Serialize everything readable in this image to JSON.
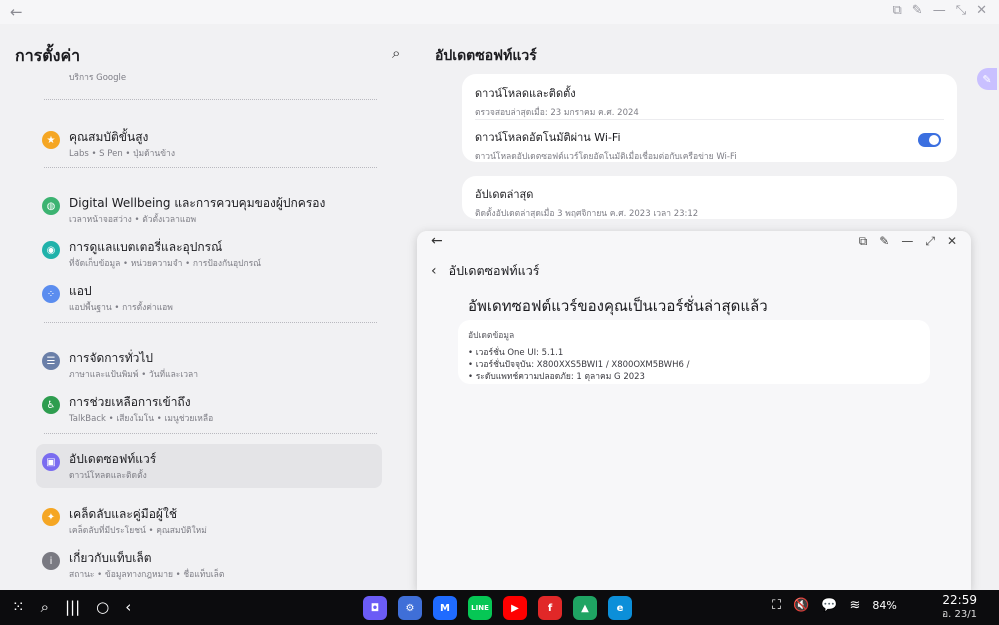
{
  "top_bar": {
    "back_icon": "arrow-left-icon"
  },
  "left_panel": {
    "title": "การตั้งค่า",
    "partial_subtitle": "บริการ Google",
    "items": [
      {
        "id": "advanced",
        "title": "คุณสมบัติขั้นสูง",
        "subtitle": "Labs  •  S Pen  •  ปุ่มด้านข้าง",
        "icon": "star-icon",
        "color": "#f5a623"
      },
      {
        "id": "wellbeing",
        "title": "Digital Wellbeing และการควบคุมของผู้ปกครอง",
        "subtitle": "เวลาหน้าจอสว่าง  •  ตัวตั้งเวลาแอพ",
        "icon": "wellbeing-icon",
        "color": "#3cb371"
      },
      {
        "id": "battery",
        "title": "การดูแลแบตเตอรี่และอุปกรณ์",
        "subtitle": "ที่จัดเก็บข้อมูล  •  หน่วยความจำ  •  การป้องกันอุปกรณ์",
        "icon": "device-care-icon",
        "color": "#20b2aa"
      },
      {
        "id": "apps",
        "title": "แอป",
        "subtitle": "แอปพื้นฐาน  •  การตั้งค่าแอพ",
        "icon": "apps-icon",
        "color": "#5b8def"
      },
      {
        "id": "general",
        "title": "การจัดการทั่วไป",
        "subtitle": "ภาษาและแป้นพิมพ์  •  วันที่และเวลา",
        "icon": "sliders-icon",
        "color": "#6a7fa8"
      },
      {
        "id": "accessibility",
        "title": "การช่วยเหลือการเข้าถึง",
        "subtitle": "TalkBack  •  เสียงโมโน  •  เมนูช่วยเหลือ",
        "icon": "accessibility-icon",
        "color": "#2e9d4f"
      },
      {
        "id": "software-update",
        "title": "อัปเดตซอฟท์แวร์",
        "subtitle": "ดาวน์โหลดและติดตั้ง",
        "icon": "software-update-icon",
        "color": "#7a6cf0"
      },
      {
        "id": "tips",
        "title": "เคล็ดลับและคู่มือผู้ใช้",
        "subtitle": "เคล็ดลับที่มีประโยชน์  •  คุณสมบัติใหม่",
        "icon": "lightbulb-icon",
        "color": "#f5a623"
      },
      {
        "id": "about",
        "title": "เกี่ยวกับแท็บเล็ต",
        "subtitle": "สถานะ  •  ข้อมูลทางกฎหมาย  •  ชื่อแท็บเล็ต",
        "icon": "info-icon",
        "color": "#7a7a82"
      }
    ]
  },
  "right_panel": {
    "title": "อัปเดตซอฟท์แวร์",
    "download_install": {
      "title": "ดาวน์โหลดและติดตั้ง",
      "subtitle": "ตรวจสอบล่าสุดเมื่อ: 23 มกราคม ค.ศ. 2024"
    },
    "auto_download": {
      "title": "ดาวน์โหลดอัตโนมัติผ่าน Wi-Fi",
      "subtitle": "ดาวน์โหลดอัปเดตซอฟต์แวร์โดยอัตโนมัติเมื่อเชื่อมต่อกับเครือข่าย Wi-Fi",
      "enabled": true
    },
    "last_update": {
      "title": "อัปเดตล่าสุด",
      "subtitle": "ติดตั้งอัปเดตล่าสุดเมื่อ 3 พฤศจิกายน ค.ศ. 2023 เวลา 23:12"
    }
  },
  "popup": {
    "header_title": "อัปเดตซอฟท์แวร์",
    "status": "อัพเดทซอฟต์แวร์ของคุณเป็นเวอร์ชั่นล่าสุดแล้ว",
    "info_heading": "อัปเดตข้อมูล",
    "info_lines": [
      "• เวอร์ชั่น One UI: 5.1.1",
      "• เวอร์ชั่นปัจจุบัน: X800XXS5BWI1 / X800OXM5BWH6 /",
      "• ระดับแพทช์ความปลอดภัย: 1 ตุลาคม G 2023"
    ]
  },
  "taskbar": {
    "apps": [
      {
        "name": "samsung-notes-app",
        "glyph": "◘",
        "color": "#6b5cf6"
      },
      {
        "name": "settings-app",
        "glyph": "⚙",
        "color": "#3f6fd8"
      },
      {
        "name": "m-app",
        "glyph": "M",
        "color": "#1f6bff"
      },
      {
        "name": "line-app",
        "glyph": "LINE",
        "color": "#06c755"
      },
      {
        "name": "youtube-app",
        "glyph": "▶",
        "color": "#ff0000"
      },
      {
        "name": "flipboard-app",
        "glyph": "f",
        "color": "#e12828"
      },
      {
        "name": "google-drive-app",
        "glyph": "▲",
        "color": "#1fa463"
      },
      {
        "name": "edge-app",
        "glyph": "e",
        "color": "#0c8fd9"
      }
    ],
    "battery": "84%",
    "time": "22:59",
    "date": "อ. 23/1"
  }
}
